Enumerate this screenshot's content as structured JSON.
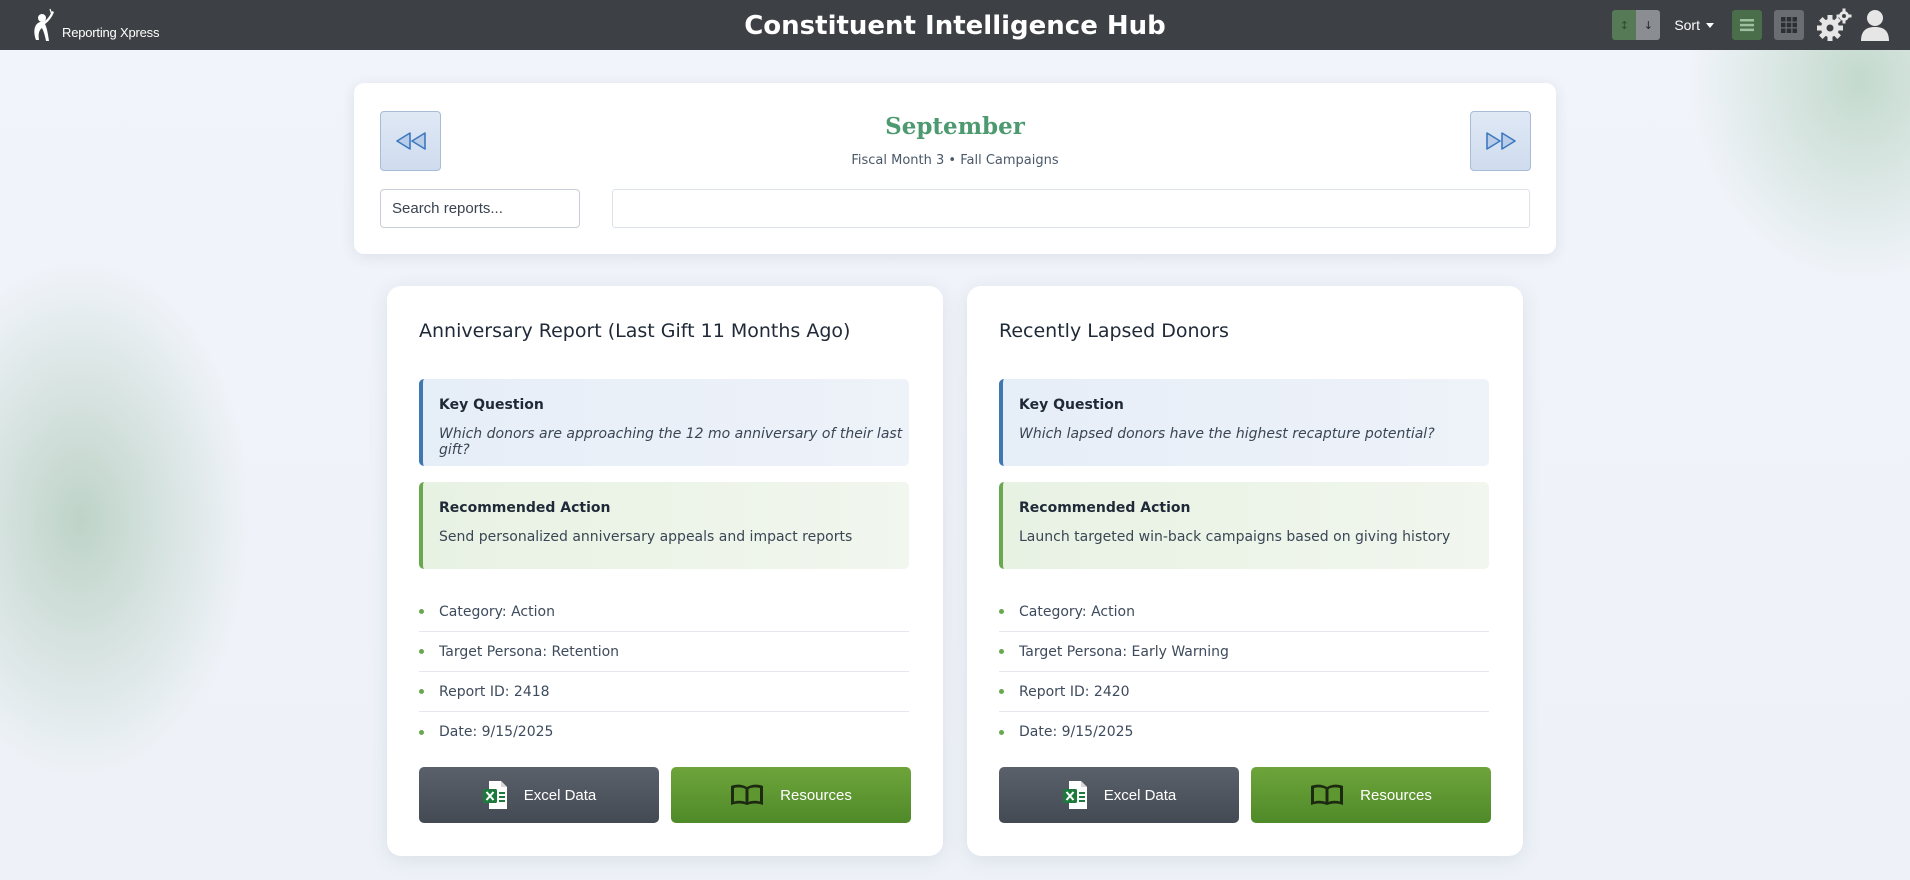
{
  "header": {
    "logo_text": "Reporting Xpress",
    "title": "Constituent Intelligence Hub",
    "order_asc_icon": "↕",
    "order_desc_icon": "↓",
    "sort_label": "Sort"
  },
  "month_nav": {
    "month": "September",
    "subtitle": "Fiscal Month 3 • Fall Campaigns",
    "search_placeholder": "Search reports..."
  },
  "reports": [
    {
      "title": "Anniversary Report (Last Gift 11 Months Ago)",
      "question_label": "Key Question",
      "question": "Which donors are approaching the 12 mo anniversary of their last gift?",
      "action_label": "Recommended Action",
      "action": "Send personalized anniversary appeals and impact reports",
      "meta": [
        "Category: Action",
        "Target Persona: Retention",
        "Report ID: 2418",
        "Date: 9/15/2025"
      ],
      "excel_label": "Excel Data",
      "resources_label": "Resources"
    },
    {
      "title": "Recently Lapsed Donors",
      "question_label": "Key Question",
      "question": "Which lapsed donors have the highest recapture potential?",
      "action_label": "Recommended Action",
      "action": "Launch targeted win-back campaigns based on giving history",
      "meta": [
        "Category: Action",
        "Target Persona: Early Warning",
        "Report ID: 2420",
        "Date: 9/15/2025"
      ],
      "excel_label": "Excel Data",
      "resources_label": "Resources"
    }
  ],
  "colors": {
    "topbar": "#3d4044",
    "accent_green": "#4e9a70",
    "question_border": "#3f78b1",
    "action_border": "#6aa84f",
    "excel_button": "#4b5159",
    "resources_button": "#5e972f"
  }
}
